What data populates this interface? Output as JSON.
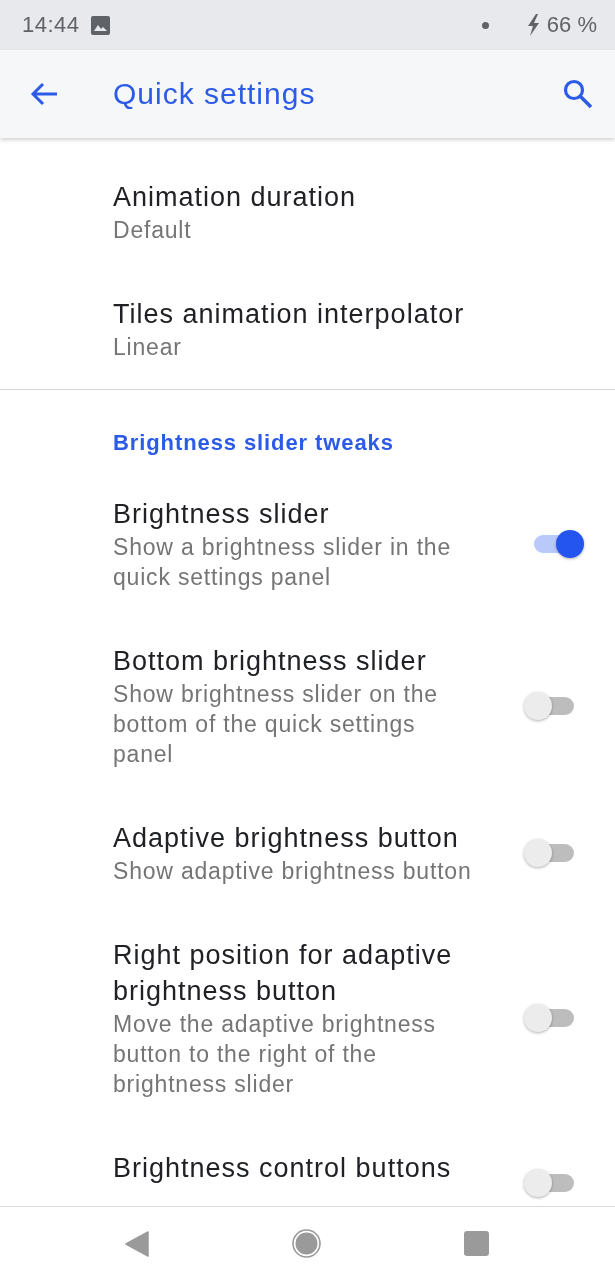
{
  "status_bar": {
    "time": "14:44",
    "battery": "66 %"
  },
  "app_bar": {
    "title": "Quick settings"
  },
  "sections": [
    {
      "items": [
        {
          "kind": "text",
          "title": "Animation duration",
          "summary": "Default"
        },
        {
          "kind": "text",
          "title": "Tiles animation interpolator",
          "summary": "Linear"
        }
      ]
    },
    {
      "category": "Brightness slider tweaks",
      "items": [
        {
          "kind": "switch",
          "title": "Brightness slider",
          "summary": "Show a brightness slider in the quick settings panel",
          "checked": true
        },
        {
          "kind": "switch",
          "title": "Bottom brightness slider",
          "summary": "Show brightness slider on the bottom of the quick settings panel",
          "checked": false
        },
        {
          "kind": "switch",
          "title": "Adaptive brightness button",
          "summary": "Show adaptive brightness button",
          "checked": false
        },
        {
          "kind": "switch",
          "title": "Right position for adaptive brightness button",
          "summary": "Move the adaptive brightness button to the right of the brightness slider",
          "checked": false
        },
        {
          "kind": "switch",
          "title": "Brightness control buttons",
          "checked": false
        }
      ]
    }
  ]
}
